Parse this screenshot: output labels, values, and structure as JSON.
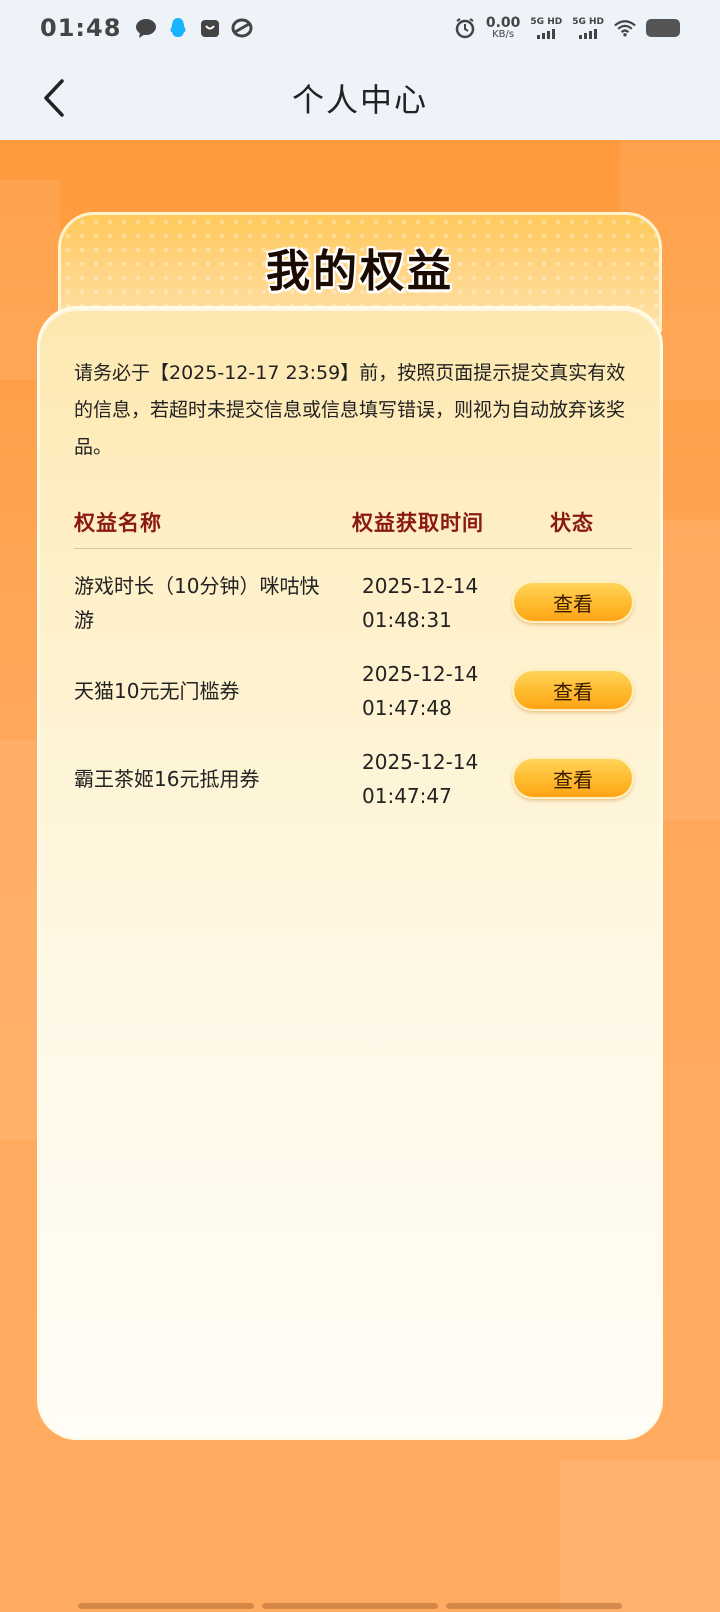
{
  "status_bar": {
    "time": "01:48",
    "net_speed_value": "0.00",
    "net_speed_unit": "KB/s",
    "sim1_label": "5G HD",
    "sim2_label": "5G HD",
    "icons": [
      "message-icon",
      "qq-icon",
      "shop-icon",
      "app-icon",
      "alarm-icon",
      "wifi-icon",
      "battery-icon"
    ]
  },
  "header": {
    "title": "个人中心",
    "back_icon": "chevron-left-icon"
  },
  "card": {
    "title": "我的权益",
    "notice": "请务必于【2025-12-17 23:59】前，按照页面提示提交真实有效的信息，若超时未提交信息或信息填写错误，则视为自动放弃该奖品。",
    "table": {
      "headers": {
        "name": "权益名称",
        "time": "权益获取时间",
        "status": "状态"
      },
      "rows": [
        {
          "name": "游戏时长（10分钟）咪咕快游",
          "date": "2025-12-14",
          "time": "01:48:31",
          "action": "查看"
        },
        {
          "name": "天猫10元无门槛券",
          "date": "2025-12-14",
          "time": "01:47:48",
          "action": "查看"
        },
        {
          "name": "霸王茶姬16元抵用券",
          "date": "2025-12-14",
          "time": "01:47:47",
          "action": "查看"
        }
      ]
    }
  },
  "colors": {
    "background": "#ffa65a",
    "header_text": "#8a1a10",
    "button": "#ffbb2e"
  }
}
